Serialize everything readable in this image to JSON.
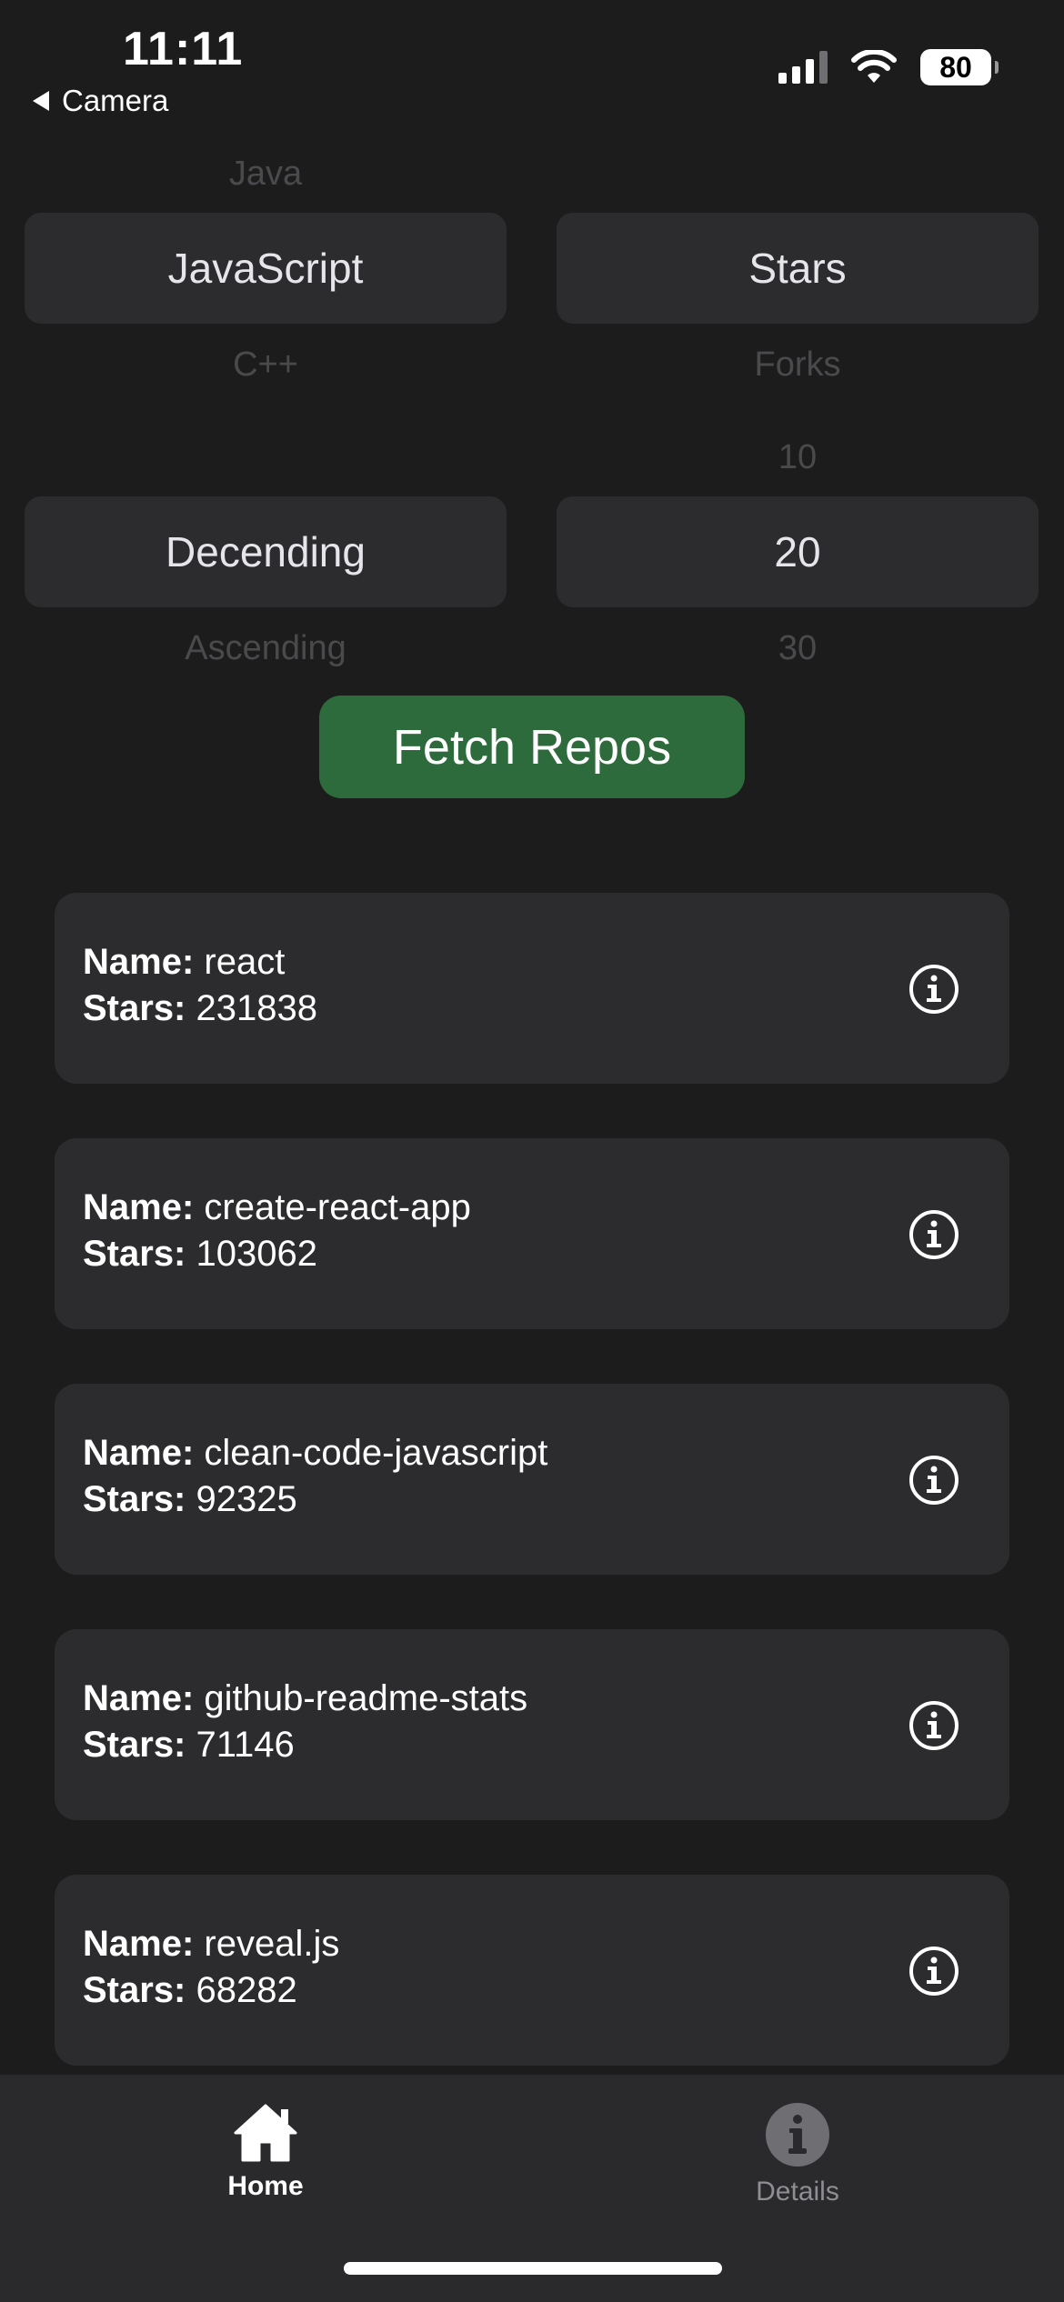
{
  "status_bar": {
    "time": "11:11",
    "back_label": "Camera",
    "battery": "80"
  },
  "pickers": {
    "language": {
      "above": "Java",
      "selected": "JavaScript",
      "below": "C++"
    },
    "sort": {
      "above": "",
      "selected": "Stars",
      "below": "Forks"
    },
    "order": {
      "above": "",
      "selected": "Decending",
      "below": "Ascending"
    },
    "count": {
      "above": "10",
      "selected": "20",
      "below": "30"
    }
  },
  "fetch_button": {
    "label": "Fetch Repos",
    "color": "#2e6b3c"
  },
  "repo_labels": {
    "name": "Name:",
    "stars": "Stars:"
  },
  "repos": [
    {
      "name": "react",
      "stars": "231838"
    },
    {
      "name": "create-react-app",
      "stars": "103062"
    },
    {
      "name": "clean-code-javascript",
      "stars": "92325"
    },
    {
      "name": "github-readme-stats",
      "stars": "71146"
    },
    {
      "name": "reveal.js",
      "stars": "68282"
    }
  ],
  "tab_bar": {
    "tabs": [
      {
        "label": "Home",
        "icon": "home-icon",
        "active": true
      },
      {
        "label": "Details",
        "icon": "info-circle-icon",
        "active": false
      }
    ]
  }
}
